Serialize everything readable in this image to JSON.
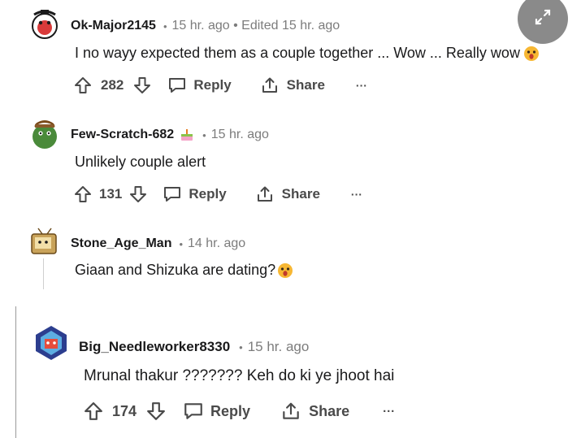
{
  "comments": [
    {
      "username": "Ok-Major2145",
      "meta": "15 hr. ago • Edited 15 hr. ago",
      "text": "I no wayy expected them as a couple together ... Wow ... Really wow",
      "votes": "282",
      "reply_label": "Reply",
      "share_label": "Share",
      "more_label": "···"
    },
    {
      "username": "Few-Scratch-682",
      "meta": "15 hr. ago",
      "text": "Unlikely couple alert",
      "votes": "131",
      "reply_label": "Reply",
      "share_label": "Share",
      "more_label": "···"
    },
    {
      "username": "Stone_Age_Man",
      "meta": "14 hr. ago",
      "text": "Giaan and Shizuka are dating?"
    },
    {
      "username": "Big_Needleworker8330",
      "meta": "15 hr. ago",
      "text": "Mrunal thakur ??????? Keh do ki ye jhoot hai",
      "votes": "174",
      "reply_label": "Reply",
      "share_label": "Share",
      "more_label": "···"
    }
  ],
  "icons": {
    "expand": "expand-arrows-icon",
    "upvote": "upvote-arrow-icon",
    "downvote": "downvote-arrow-icon",
    "reply": "speech-bubble-icon",
    "share": "share-upload-icon",
    "emoji": "surprised-face-emoji"
  },
  "colors": {
    "text": "#1a1a1b",
    "muted": "#7c7c7c",
    "action": "#4a4a4a",
    "expand_bg": "#8a8a8a"
  }
}
